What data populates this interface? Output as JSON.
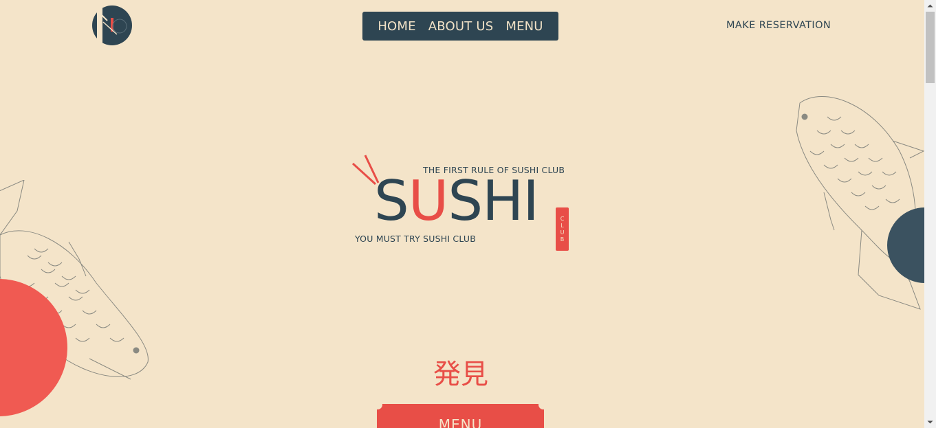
{
  "nav": {
    "items": [
      {
        "label": "HOME"
      },
      {
        "label": "ABOUT US"
      },
      {
        "label": "MENU"
      }
    ],
    "reservation_label": "MAKE RESERVATION"
  },
  "hero": {
    "tagline_top": "THE FIRST RULE OF SUSHI CLUB",
    "word_part1": "S",
    "word_part2": "U",
    "word_part3": "SHI",
    "club_letters": [
      "C",
      "L",
      "U",
      "B"
    ],
    "tagline_bottom": "YOU MUST TRY SUSHI CLUB"
  },
  "discover": {
    "kanji": "発見",
    "button_label": "MENU"
  },
  "colors": {
    "background": "#f4e4c9",
    "navy": "#2e4552",
    "accent_red": "#e84e47"
  },
  "icons": {
    "badge": "sushi-club-badge-icon",
    "chopsticks": "chopsticks-icon",
    "fish": "koi-fish-icon"
  }
}
